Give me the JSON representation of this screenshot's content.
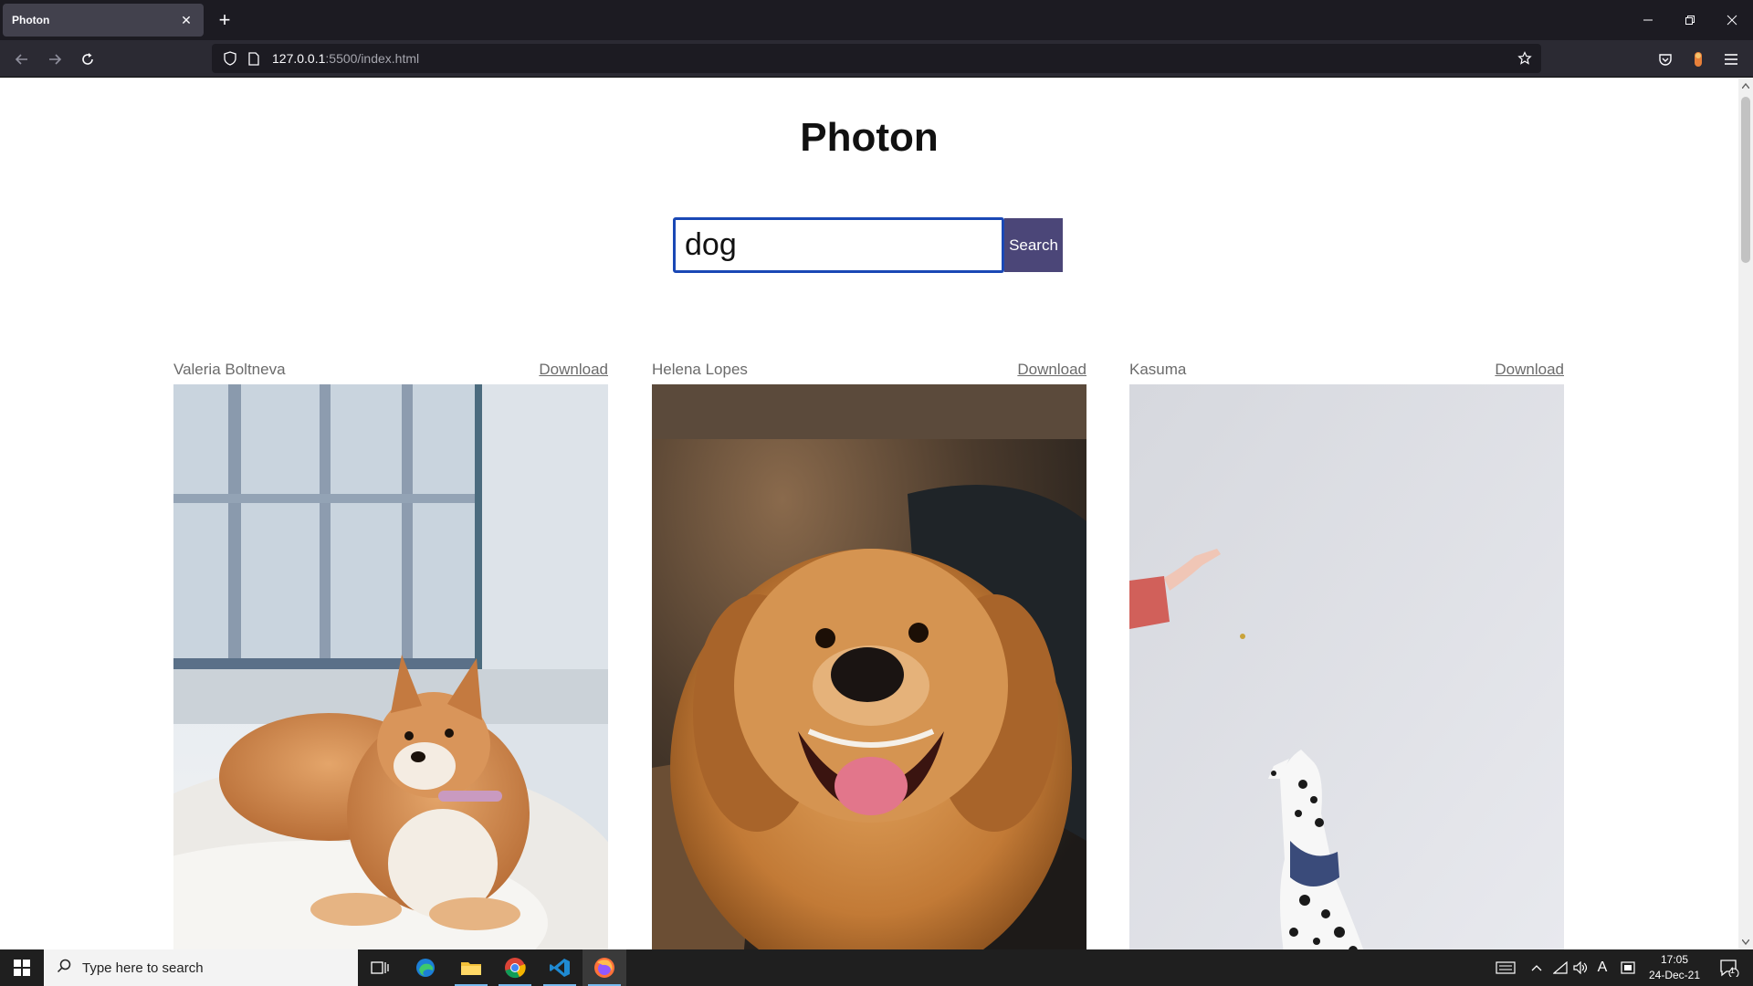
{
  "browser": {
    "tab_title": "Photon",
    "url_host": "127.0.0.1",
    "url_rest": ":5500/index.html"
  },
  "page": {
    "title": "Photon",
    "search": {
      "value": "dog",
      "button_label": "Search"
    },
    "results": [
      {
        "author": "Valeria Boltneva",
        "download_label": "Download",
        "icon": "shiba-inu-photo"
      },
      {
        "author": "Helena Lopes",
        "download_label": "Download",
        "icon": "golden-retriever-photo"
      },
      {
        "author": "Kasuma",
        "download_label": "Download",
        "icon": "dalmatian-photo"
      }
    ]
  },
  "taskbar": {
    "search_placeholder": "Type here to search",
    "time": "17:05",
    "date": "24-Dec-21",
    "notification_count": "1"
  },
  "colors": {
    "search_border": "#1a48b5",
    "search_button": "#4b4678",
    "tab_strip": "#1c1b22"
  }
}
